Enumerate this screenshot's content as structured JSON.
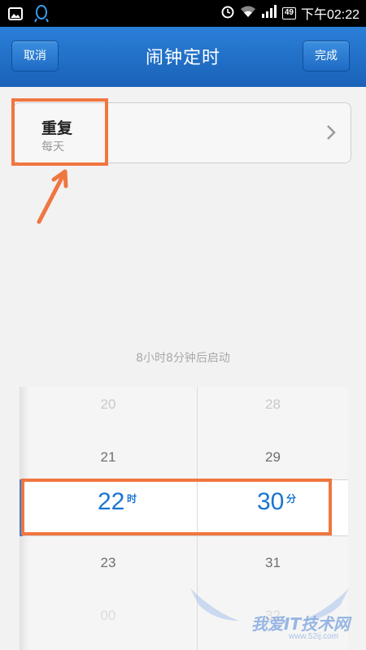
{
  "statusbar": {
    "time": "下午02:22",
    "battery": "49",
    "icons": [
      "image-icon",
      "qq-icon",
      "alarm-icon",
      "wifi-icon",
      "signal-icon",
      "battery-icon"
    ]
  },
  "header": {
    "cancel_label": "取消",
    "title": "闹钟定时",
    "done_label": "完成"
  },
  "repeat": {
    "title": "重复",
    "value": "每天"
  },
  "countdown": "8小时8分钟后启动",
  "picker": {
    "hours": [
      "20",
      "21",
      "22",
      "23",
      "00"
    ],
    "minutes": [
      "28",
      "29",
      "30",
      "31",
      "32"
    ],
    "selected_hour": "22",
    "hour_unit": "时",
    "selected_minute": "30",
    "minute_unit": "分"
  },
  "watermark": {
    "text": "我爱IT技术网",
    "url": "www.52ij.com"
  },
  "colors": {
    "header": "#1f6ec9",
    "accent": "#1b74d0",
    "highlight": "#f07640"
  }
}
